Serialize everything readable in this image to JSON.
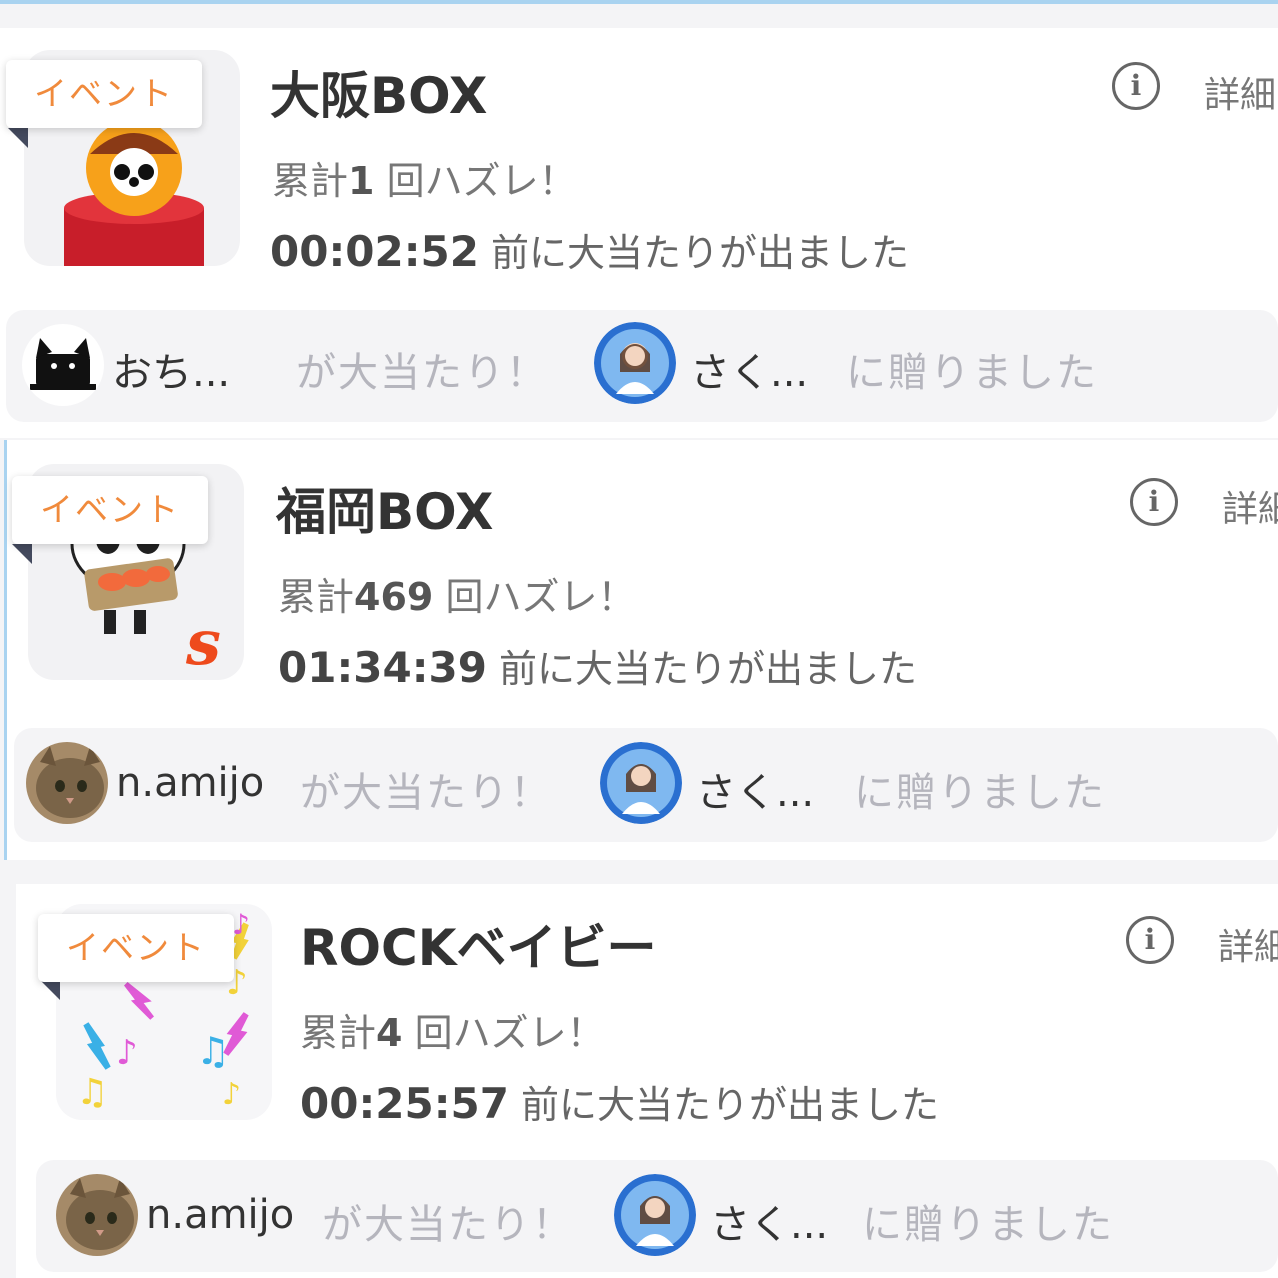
{
  "tag_label": "イベント",
  "detail_label": "詳細",
  "info_glyph": "i",
  "cards": [
    {
      "title": "大阪BOX",
      "miss_prefix": "累計",
      "miss_count": "1",
      "miss_suffix": "回ハズレ！",
      "elapsed": "00:02:52",
      "elapsed_suffix": "前に大当たりが出ました",
      "winner": "おち...",
      "winner_suffix": "が大当たり！",
      "recipient": "さく...",
      "recipient_suffix": "に贈りました"
    },
    {
      "title": "福岡BOX",
      "miss_prefix": "累計",
      "miss_count": "469",
      "miss_suffix": "回ハズレ！",
      "elapsed": "01:34:39",
      "elapsed_suffix": "前に大当たりが出ました",
      "winner": "n.amijo",
      "winner_suffix": "が大当たり！",
      "recipient": "さく...",
      "recipient_suffix": "に贈りました"
    },
    {
      "title": "ROCKベイビー",
      "miss_prefix": "累計",
      "miss_count": "4",
      "miss_suffix": "回ハズレ！",
      "elapsed": "00:25:57",
      "elapsed_suffix": "前に大当たりが出ました",
      "winner": "n.amijo",
      "winner_suffix": "が大当たり！",
      "recipient": "さく...",
      "recipient_suffix": "に贈りました"
    }
  ],
  "colors": {
    "accent_orange": "#f08a3c",
    "top_blue": "#a9d3f0",
    "muted_text": "#b5b5bd"
  },
  "icons": [
    "takoyaki-icon",
    "panda-sushi-icon",
    "music-notes-icon",
    "info-icon",
    "cat-avatar-icon",
    "idol-avatar-icon"
  ]
}
